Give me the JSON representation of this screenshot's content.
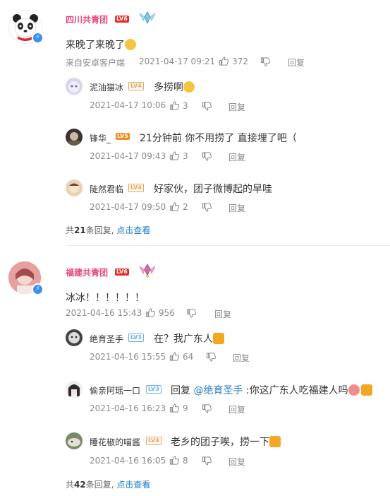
{
  "threads": [
    {
      "user": "四川共青团",
      "level": "LV6",
      "text": "来晚了来晚了",
      "source": "来自安卓客户端",
      "time": "2021-04-17 09:21",
      "likes": "372",
      "reply": "回复",
      "replies": [
        {
          "user": "泥油猫冰",
          "level": "LV4",
          "text": "多捞啊",
          "time": "2021-04-17 10:06",
          "likes": "3",
          "reply": "回复"
        },
        {
          "user": "锋华_",
          "level": "LV5",
          "text": "21分钟前 你不用捞了 直接埋了吧（",
          "time": "2021-04-17 09:43",
          "likes": "3",
          "reply": "回复"
        },
        {
          "user": "陡然君临",
          "level": "LV4",
          "text": "好家伙，团子微博起的早哇",
          "time": "2021-04-17 09:50",
          "likes": "2",
          "reply": "回复"
        }
      ],
      "more_prefix": "共",
      "more_count": "21",
      "more_suffix": "条回复, ",
      "more_link": "点击查看"
    },
    {
      "user": "福建共青团",
      "level": "LV6",
      "text": "冰冰！！！！！！",
      "time": "2021-04-16 15:43",
      "likes": "956",
      "reply": "回复",
      "replies": [
        {
          "user": "绝育圣手",
          "level": "LV3",
          "text": "在？我广东人",
          "time": "2021-04-16 15:55",
          "likes": "64",
          "reply": "回复"
        },
        {
          "user": "偷亲阿瑶一口",
          "level": "LV3",
          "text_prefix": "回复 ",
          "mention": "@绝育圣手",
          "text": " :你这广东人吃福建人吗",
          "time": "2021-04-16 16:23",
          "likes": "9",
          "reply": "回复"
        },
        {
          "user": "睡花椒的喵酱",
          "level": "LV4",
          "text": "老乡的团子唉，捞一下",
          "time": "2021-04-16 16:05",
          "likes": "8",
          "reply": "回复"
        }
      ],
      "more_prefix": "共",
      "more_count": "42",
      "more_suffix": "条回复, ",
      "more_link": "点击查看"
    }
  ],
  "colors": {
    "accent": "#e8467c",
    "link": "#1f7bc1",
    "lv6": "#e42b2b"
  }
}
